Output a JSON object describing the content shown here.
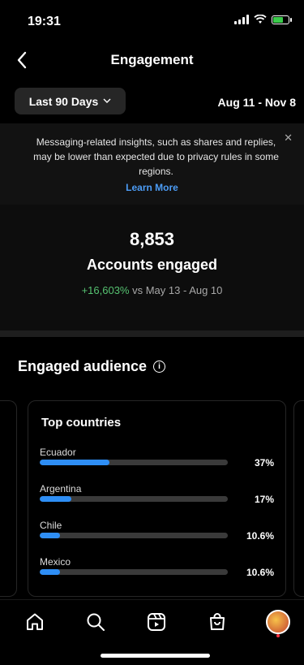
{
  "status": {
    "time": "19:31"
  },
  "header": {
    "title": "Engagement"
  },
  "filter": {
    "label": "Last 90 Days",
    "range": "Aug 11 - Nov 8"
  },
  "notice": {
    "text": "Messaging-related insights, such as shares and replies, may be lower than expected due to privacy rules in some regions.",
    "link": "Learn More"
  },
  "summary": {
    "count": "8,853",
    "label": "Accounts engaged",
    "change": "+16,603%",
    "comparison": " vs May 13 - Aug 10"
  },
  "audience": {
    "title": "Engaged audience",
    "card_title": "Top countries",
    "countries": [
      {
        "name": "Ecuador",
        "pct": "37%",
        "value": 37
      },
      {
        "name": "Argentina",
        "pct": "17%",
        "value": 17
      },
      {
        "name": "Chile",
        "pct": "10.6%",
        "value": 10.6
      },
      {
        "name": "Mexico",
        "pct": "10.6%",
        "value": 10.6
      }
    ]
  },
  "colors": {
    "accent": "#2e8ef5",
    "positive": "#56c271",
    "link": "#4c9cf5"
  },
  "tabbar": {
    "items": [
      "home-icon",
      "search-icon",
      "reels-icon",
      "shop-icon",
      "profile-avatar"
    ]
  }
}
